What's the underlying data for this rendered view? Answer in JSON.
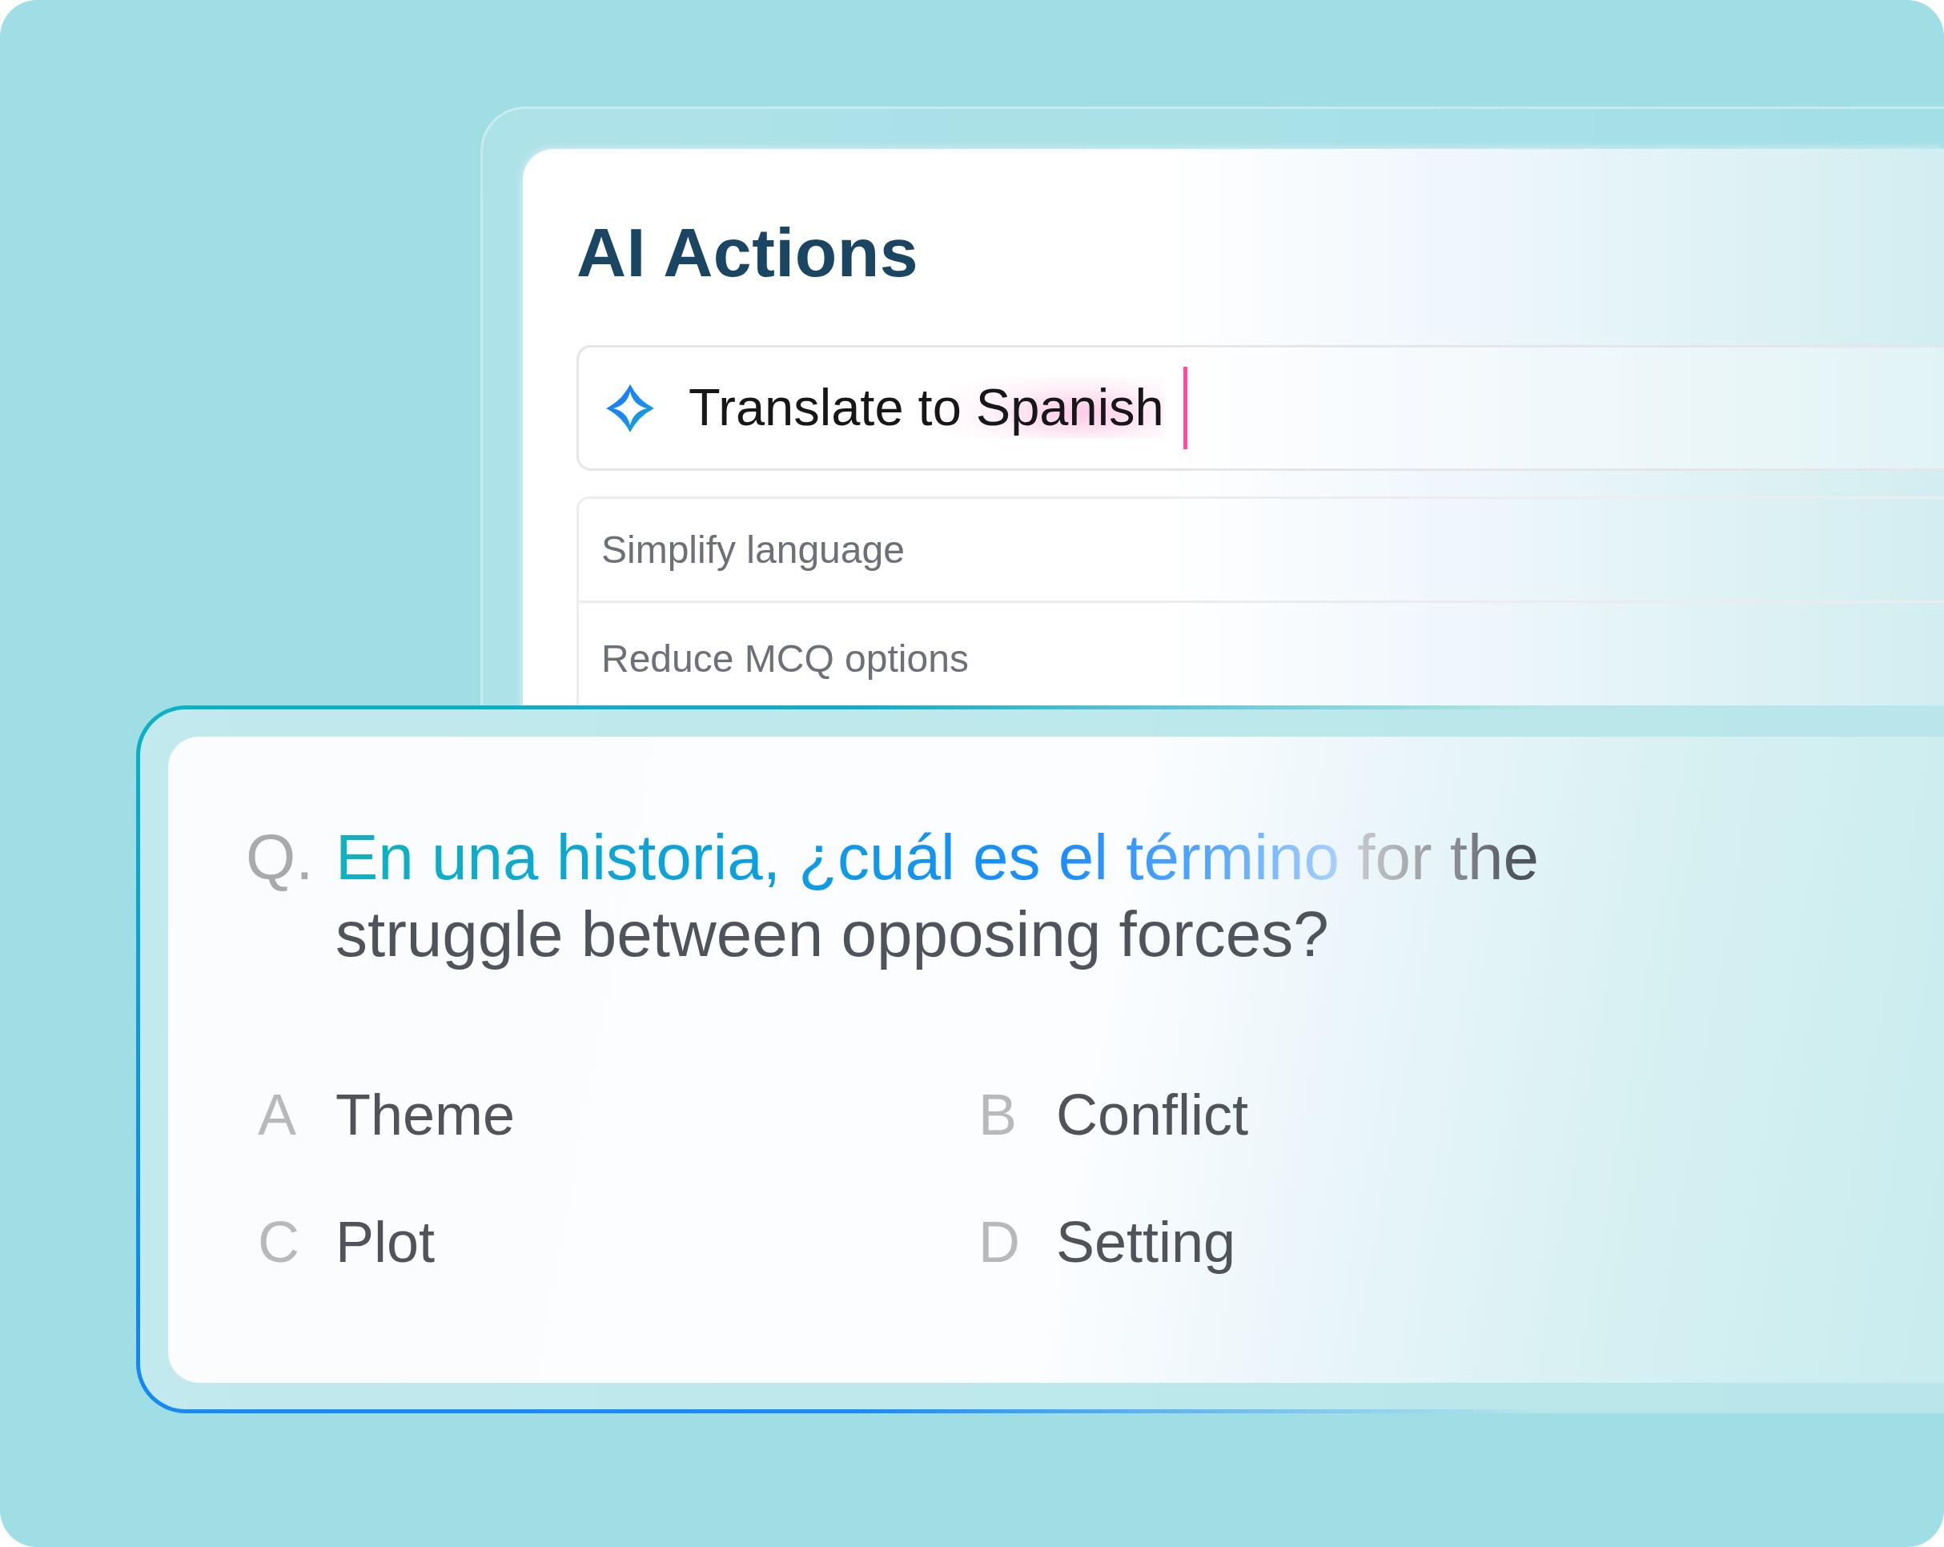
{
  "panel": {
    "title": "AI Actions",
    "prompt": {
      "value": "Translate to Spanish",
      "focused": true
    },
    "actions": [
      {
        "label": "Simplify language"
      },
      {
        "label": "Reduce MCQ options"
      }
    ]
  },
  "question": {
    "label": "Q.",
    "segments": [
      {
        "kind": "translated",
        "text": "En una historia, ¿cuál es el término"
      },
      {
        "kind": "source",
        "text": "for the struggle between opposing forces?"
      }
    ],
    "options": [
      {
        "letter": "A",
        "text": "Theme"
      },
      {
        "letter": "B",
        "text": "Conflict"
      },
      {
        "letter": "C",
        "text": "Plot"
      },
      {
        "letter": "D",
        "text": "Setting"
      }
    ]
  }
}
